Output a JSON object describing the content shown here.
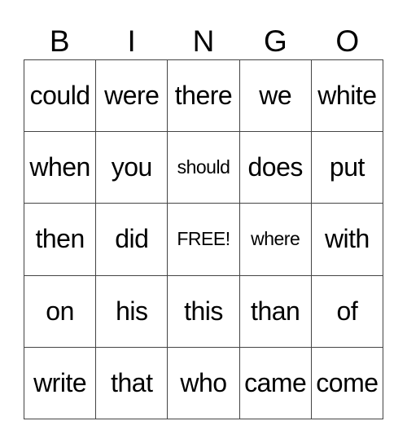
{
  "header": [
    "B",
    "I",
    "N",
    "G",
    "O"
  ],
  "cells": [
    [
      "could",
      "were",
      "there",
      "we",
      "white"
    ],
    [
      "when",
      "you",
      "should",
      "does",
      "put"
    ],
    [
      "then",
      "did",
      "FREE!",
      "where",
      "with"
    ],
    [
      "on",
      "his",
      "this",
      "than",
      "of"
    ],
    [
      "write",
      "that",
      "who",
      "came",
      "come"
    ]
  ]
}
